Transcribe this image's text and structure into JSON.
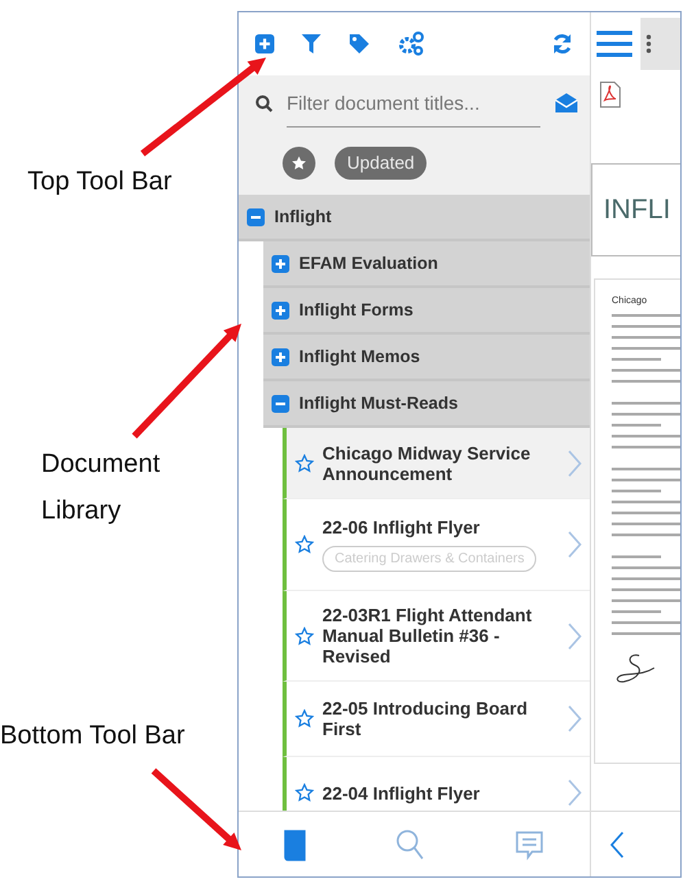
{
  "annotations": [
    {
      "text": "Top Tool Bar",
      "kind": "top"
    },
    {
      "text": "Document Library",
      "kind": "middle"
    },
    {
      "text": "Bottom Tool Bar",
      "kind": "bottom"
    }
  ],
  "search": {
    "placeholder": "Filter document titles..."
  },
  "filters": [
    {
      "kind": "star",
      "selected": false
    },
    {
      "kind": "label",
      "text": "Updated",
      "selected": false
    }
  ],
  "tree": [
    {
      "label": "Inflight",
      "expanded": true,
      "children": [
        {
          "label": "EFAM Evaluation",
          "expanded": false
        },
        {
          "label": "Inflight Forms",
          "expanded": false
        },
        {
          "label": "Inflight Memos",
          "expanded": false
        },
        {
          "label": "Inflight Must-Reads",
          "expanded": true
        }
      ]
    }
  ],
  "documents": [
    {
      "title": "Chicago Midway Service Announcement",
      "starred": false,
      "selected": true
    },
    {
      "title": "22-06 Inflight Flyer",
      "starred": false,
      "selected": false,
      "tags": [
        "Catering Drawers & Containers"
      ]
    },
    {
      "title": "22-03R1 Flight Attendant Manual Bulletin #36 - Revised",
      "starred": false,
      "selected": false
    },
    {
      "title": "22-05 Introducing Board First",
      "starred": false,
      "selected": false
    },
    {
      "title": "22-04 Inflight Flyer",
      "starred": false,
      "selected": false
    }
  ],
  "bottom_bar": [
    {
      "kind": "library",
      "selected": true
    },
    {
      "kind": "search",
      "selected": false
    },
    {
      "kind": "messages",
      "selected": false
    }
  ],
  "preview": {
    "banner": "INFLI",
    "doc_title": "Chicago"
  }
}
